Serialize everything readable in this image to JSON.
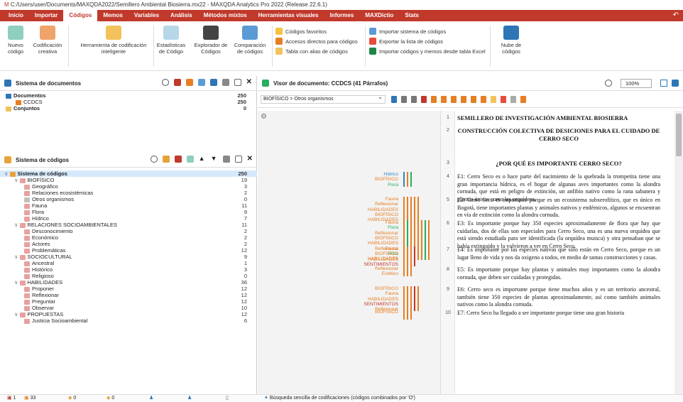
{
  "title": "C:/Users/user/Documents/MAXQDA2022/Semillero Ambiental Biosierra.mx22 - MAXQDA Analytics Pro 2022 (Release 22.6.1)",
  "menu": [
    "Inicio",
    "Importar",
    "Códigos",
    "Memos",
    "Variables",
    "Análisis",
    "Métodos mixtos",
    "Herramientas visuales",
    "Informes",
    "MAXDictio",
    "Stats"
  ],
  "ribbon": {
    "nuevo": "Nuevo código",
    "creativa": "Codificación creativa",
    "inteligente": "Herramienta de codificación inteligente",
    "estadisticas": "Estadísticas de Código",
    "explorador": "Explorador de Códigos",
    "comparacion": "Comparación de códigos",
    "favoritos": "Códigos favoritos",
    "accesos": "Accesos directos para códigos",
    "alias": "Tabla con alias de códigos",
    "importar": "Importar sistema de códigos",
    "exportar": "Exportar la lista de códigos",
    "importarexcel": "Importar códigos y memos desde tabla Excel",
    "nube": "Nube de códigos"
  },
  "docs": {
    "header": "Sistema de documentos",
    "items": [
      {
        "label": "Documentos",
        "count": "250"
      },
      {
        "label": "CCDCS",
        "count": "250"
      },
      {
        "label": "Conjuntos",
        "count": "0"
      }
    ]
  },
  "codes": {
    "header": "Sistema de códigos",
    "items": [
      {
        "label": "Sistema de códigos",
        "count": "250",
        "lvl": 0,
        "c": "#e8a23a"
      },
      {
        "label": "BIOFÍSICO",
        "count": "19",
        "lvl": 1,
        "c": "#e8a0a0"
      },
      {
        "label": "Geográfico",
        "count": "3",
        "lvl": 2,
        "c": "#e8a0a0"
      },
      {
        "label": "Relaciones ecosistémicas",
        "count": "2",
        "lvl": 2,
        "c": "#e8a0a0"
      },
      {
        "label": "Otros organismos",
        "count": "0",
        "lvl": 2,
        "c": "#c0c0c0"
      },
      {
        "label": "Fauna",
        "count": "11",
        "lvl": 2,
        "c": "#e8a0a0"
      },
      {
        "label": "Flora",
        "count": "9",
        "lvl": 2,
        "c": "#e8a0a0"
      },
      {
        "label": "Hídrico",
        "count": "7",
        "lvl": 2,
        "c": "#e8a0a0"
      },
      {
        "label": "RELACIONES SOCIOAMBIENTALES",
        "count": "11",
        "lvl": 1,
        "c": "#e8a0a0"
      },
      {
        "label": "Desconocimiento",
        "count": "2",
        "lvl": 2,
        "c": "#e8a0a0"
      },
      {
        "label": "Económico",
        "count": "2",
        "lvl": 2,
        "c": "#e8a0a0"
      },
      {
        "label": "Actores",
        "count": "2",
        "lvl": 2,
        "c": "#e8a0a0"
      },
      {
        "label": "Problemáticas",
        "count": "12",
        "lvl": 2,
        "c": "#e8a0a0"
      },
      {
        "label": "SOCIOCULTURAL",
        "count": "9",
        "lvl": 1,
        "c": "#e8a0a0"
      },
      {
        "label": "Ancestral",
        "count": "1",
        "lvl": 2,
        "c": "#e8a0a0"
      },
      {
        "label": "Histórico",
        "count": "3",
        "lvl": 2,
        "c": "#e8a0a0"
      },
      {
        "label": "Religioso",
        "count": "0",
        "lvl": 2,
        "c": "#e8a0a0"
      },
      {
        "label": "HABILIDADES",
        "count": "36",
        "lvl": 1,
        "c": "#e8a0a0"
      },
      {
        "label": "Proponer",
        "count": "12",
        "lvl": 2,
        "c": "#e8a0a0"
      },
      {
        "label": "Reflexionar",
        "count": "12",
        "lvl": 2,
        "c": "#e8a0a0"
      },
      {
        "label": "Preguntar",
        "count": "12",
        "lvl": 2,
        "c": "#e8a0a0"
      },
      {
        "label": "Observar",
        "count": "10",
        "lvl": 2,
        "c": "#e8a0a0"
      },
      {
        "label": "PROPUESTAS",
        "count": "12",
        "lvl": 1,
        "c": "#e8a0a0"
      },
      {
        "label": "Justicia Socioambiental",
        "count": "6",
        "lvl": 2,
        "c": "#e8a0a0"
      }
    ]
  },
  "viewer": {
    "header": "Visor de documento: CCDCS  (41 Párrafos)",
    "breadcrumb": "BIOFÍSICO > Otros organismos",
    "zoom": "100%"
  },
  "paragraphs": [
    {
      "n": "1",
      "text": "SEMILLERO DE INVESTIGACIÓN AMBIENTAL BIOSIERRA"
    },
    {
      "n": "2",
      "text": "CONSTRUCCIÓN COLECTIVA DE DESICIONES PARA EL CUIDADO DE CERRO SECO"
    },
    {
      "n": "3",
      "text": "¿POR QUÉ ES IMPORTANTE CERRO SECO?"
    },
    {
      "n": "4",
      "text": "E1: Cerro Seco es o hace parte del nacimiento de la quebrada la trompetita tiene una gran importancia hídrica, es el hogar de algunas aves importantes como la alondra cornuda, que está en peligro de extinción, un anfibio nativo como la rana sabanera y plantas únicas como las orquídeas."
    },
    {
      "n": "5",
      "text": "E2: Cerro Seco es importante porque es un ecosistema subxerofítico, que es único en Bogotá, tiene importantes plantas y animales nativos y endémicos, algunos se encuentran en vía de extinción como la alondra cornuda."
    },
    {
      "n": "6",
      "text": "E3: Es importante porque hay 350 especies aproximadamente de flora que hay que cuidarlas, dos de ellas son especiales para Cerro Seco, una es una nueva orquídea que está siendo estudiada para ser identificada (la orquídea muisca) y otra pensaban que se había extinguido y la volvieron a ver en Cerro Seco."
    },
    {
      "n": "7",
      "text": "E4: Es importante por las especies nativas que sólo están en Cerro Seco, porque es un lugar lleno de vida y nos da oxigeno a todos, en medio de tantas construcciones y casas."
    },
    {
      "n": "8",
      "text": "E5: Es importante porque hay plantas y animales muy importantes como la alondra cornuda, que deben ser cuidadas y protegidas."
    },
    {
      "n": "9",
      "text": "E6: Cerro seco es importante porque tiene muchos años y es un territorio ancestral, también tiene 350 especies de plantas aproximadamente, así como también animales nativos como la alondra cornuda."
    },
    {
      "n": "10",
      "text": "E7: Cerro Seco ha llegado a ser importante porque tiene una gran historia"
    }
  ],
  "codelabels": [
    {
      "t": "Hídrico",
      "c": "#2e86c1"
    },
    {
      "t": "BIOFÍSICO",
      "c": "#e67e22"
    },
    {
      "t": "Flora",
      "c": "#27ae60"
    },
    {
      "t": "Fauna",
      "c": "#e67e22"
    },
    {
      "t": "Reflexionar",
      "c": "#e67e22"
    },
    {
      "t": "HABILIDADES",
      "c": "#e67e22"
    },
    {
      "t": "BIOFÍSICO",
      "c": "#e67e22"
    },
    {
      "t": "HABILIDADES",
      "c": "#e67e22"
    },
    {
      "t": "Fauna",
      "c": "#e67e22"
    },
    {
      "t": "Flora",
      "c": "#27ae60"
    },
    {
      "t": "Reflexionar",
      "c": "#e67e22"
    },
    {
      "t": "BIOFÍSICO",
      "c": "#e67e22"
    },
    {
      "t": "HABILIDADES",
      "c": "#e67e22"
    },
    {
      "t": "Fauna",
      "c": "#e67e22"
    },
    {
      "t": "Flora",
      "c": "#27ae60"
    },
    {
      "t": "HABILIDADES",
      "c": "#e67e22"
    },
    {
      "t": "Reflexionar",
      "c": "#e67e22"
    },
    {
      "t": "BIOFÍSICO",
      "c": "#e67e22"
    },
    {
      "t": "HABILIDADES",
      "c": "#e67e22"
    },
    {
      "t": "SENTIMIENTOS",
      "c": "#c0392b"
    },
    {
      "t": "Reflexionar",
      "c": "#e67e22"
    },
    {
      "t": "Estético",
      "c": "#e67e22"
    },
    {
      "t": "BIOFÍSICO",
      "c": "#e67e22"
    },
    {
      "t": "Fauna",
      "c": "#e67e22"
    },
    {
      "t": "HABILIDADES",
      "c": "#e67e22"
    },
    {
      "t": "SENTIMIENTOS",
      "c": "#c0392b"
    },
    {
      "t": "Reflexionar",
      "c": "#e67e22"
    },
    {
      "t": "BIOFÍSICO",
      "c": "#e67e22"
    }
  ],
  "status": {
    "a": "1",
    "b": "33",
    "c": "0",
    "d": "0",
    "search": "Búsqueda sencilla de codificaciones (códigos combinados por 'O')"
  }
}
